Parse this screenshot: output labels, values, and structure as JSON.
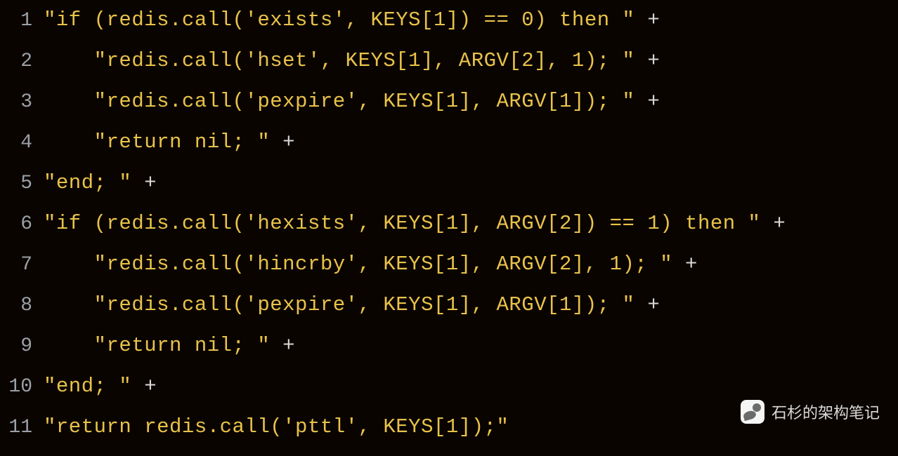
{
  "lines": [
    {
      "n": "1",
      "plain": "\"if (redis.call('exists', KEYS[1]) == 0) then \" ",
      "plus": "+"
    },
    {
      "n": "2",
      "plain": "    \"redis.call('hset', KEYS[1], ARGV[2], 1); \" ",
      "plus": "+"
    },
    {
      "n": "3",
      "plain": "    \"redis.call('pexpire', KEYS[1], ARGV[1]); \" ",
      "plus": "+"
    },
    {
      "n": "4",
      "plain": "    \"return nil; \" ",
      "plus": "+"
    },
    {
      "n": "5",
      "plain": "\"end; \" ",
      "plus": "+"
    },
    {
      "n": "6",
      "plain": "\"if (redis.call('hexists', KEYS[1], ARGV[2]) == 1) then \" ",
      "plus": "+"
    },
    {
      "n": "7",
      "plain": "    \"redis.call('hincrby', KEYS[1], ARGV[2], 1); \" ",
      "plus": "+"
    },
    {
      "n": "8",
      "plain": "    \"redis.call('pexpire', KEYS[1], ARGV[1]); \" ",
      "plus": "+"
    },
    {
      "n": "9",
      "plain": "    \"return nil; \" ",
      "plus": "+"
    },
    {
      "n": "10",
      "plain": "\"end; \" ",
      "plus": "+"
    },
    {
      "n": "11",
      "plain": "\"return redis.call('pttl', KEYS[1]);\"",
      "plus": ""
    }
  ],
  "watermark": "石杉的架构笔记"
}
